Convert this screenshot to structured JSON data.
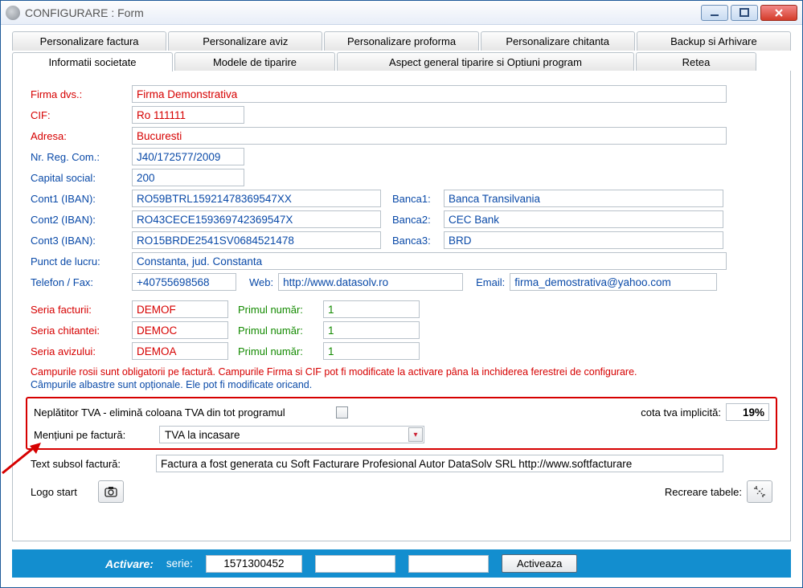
{
  "window": {
    "title": "CONFIGURARE : Form"
  },
  "tabs_top": [
    "Personalizare factura",
    "Personalizare aviz",
    "Personalizare proforma",
    "Personalizare chitanta",
    "Backup si Arhivare"
  ],
  "tabs_bottom": {
    "t0": "Informatii societate",
    "t1": "Modele de tiparire",
    "t2": "Aspect general tiparire si Optiuni program",
    "t3": "Retea"
  },
  "labels": {
    "firma": "Firma dvs.:",
    "cif": "CIF:",
    "adresa": "Adresa:",
    "nrreg": "Nr. Reg. Com.:",
    "capital": "Capital social:",
    "cont1": "Cont1 (IBAN):",
    "cont2": "Cont2 (IBAN):",
    "cont3": "Cont3 (IBAN):",
    "banca1": "Banca1:",
    "banca2": "Banca2:",
    "banca3": "Banca3:",
    "punct": "Punct de lucru:",
    "telfax": "Telefon / Fax:",
    "web": "Web:",
    "email": "Email:",
    "seria_facturii": "Seria facturii:",
    "seria_chitantei": "Seria chitantei:",
    "seria_avizului": "Seria avizului:",
    "primul_numar": "Primul număr:",
    "neplatitor": "Neplătitor TVA - elimină coloana TVA din tot programul",
    "cota": "cota tva implicită:",
    "mentiuni": "Mențiuni pe factură:",
    "text_subsol": "Text subsol factură:",
    "logo": "Logo start",
    "recreare": "Recreare tabele:",
    "activare": "Activare:",
    "serie": "serie:",
    "activeaza": "Activeaza"
  },
  "values": {
    "firma": "Firma Demonstrativa",
    "cif": "Ro 111111",
    "adresa": "Bucuresti",
    "nrreg": "J40/172577/2009",
    "capital": "200",
    "cont1": "RO59BTRL15921478369547XX",
    "cont2": "RO43CECE159369742369547X",
    "cont3": "RO15BRDE2541SV0684521478",
    "banca1": "Banca Transilvania",
    "banca2": "CEC Bank",
    "banca3": "BRD",
    "punct": "Constanta, jud. Constanta",
    "telfax": "+40755698568",
    "web": "http://www.datasolv.ro",
    "email": "firma_demostrativa@yahoo.com",
    "seria_facturii": "DEMOF",
    "seria_chitantei": "DEMOC",
    "seria_avizului": "DEMOA",
    "primul_f": "1",
    "primul_c": "1",
    "primul_a": "1",
    "cota": "19%",
    "mentiuni_sel": "TVA la incasare",
    "subsol": "Factura a fost generata cu Soft Facturare Profesional Autor DataSolv SRL http://www.softfacturare",
    "act_serie": "1571300452"
  },
  "hints": {
    "red": "Campurile rosii sunt obligatorii pe factură. Campurile Firma si CIF pot fi modificate la activare pâna la inchiderea ferestrei de configurare.",
    "blue": "Câmpurile albastre sunt opționale. Ele pot fi modificate oricand."
  }
}
